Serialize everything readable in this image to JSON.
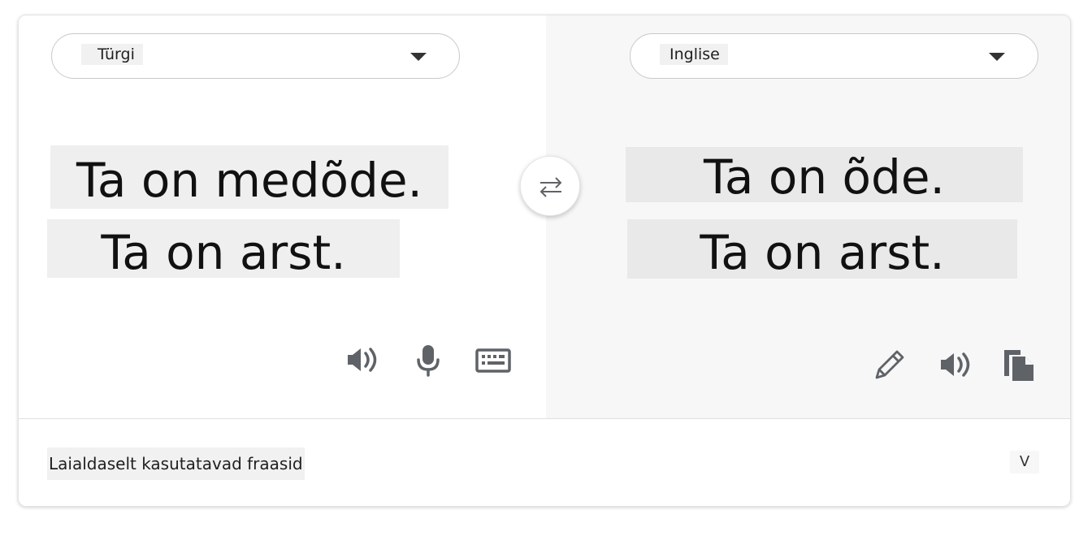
{
  "source": {
    "language": "Türgi",
    "lines": [
      "Ta on medõde.",
      "Ta on arst."
    ],
    "tools": {
      "listen_icon": "speaker-icon",
      "voice_icon": "microphone-icon",
      "keyboard_icon": "keyboard-icon"
    }
  },
  "target": {
    "language": "Inglise",
    "lines": [
      "Ta on õde.",
      "Ta on arst."
    ],
    "tools": {
      "edit_icon": "pencil-icon",
      "listen_icon": "speaker-icon",
      "copy_icon": "copy-icon"
    }
  },
  "swap_icon": "swap-arrows-icon",
  "footer": {
    "label": "Laialdaselt kasutatavad fraasid",
    "expand_label": "V"
  },
  "colors": {
    "target_pane_bg": "#f7f7f7",
    "icon": "#5f6368",
    "text": "#111111"
  }
}
